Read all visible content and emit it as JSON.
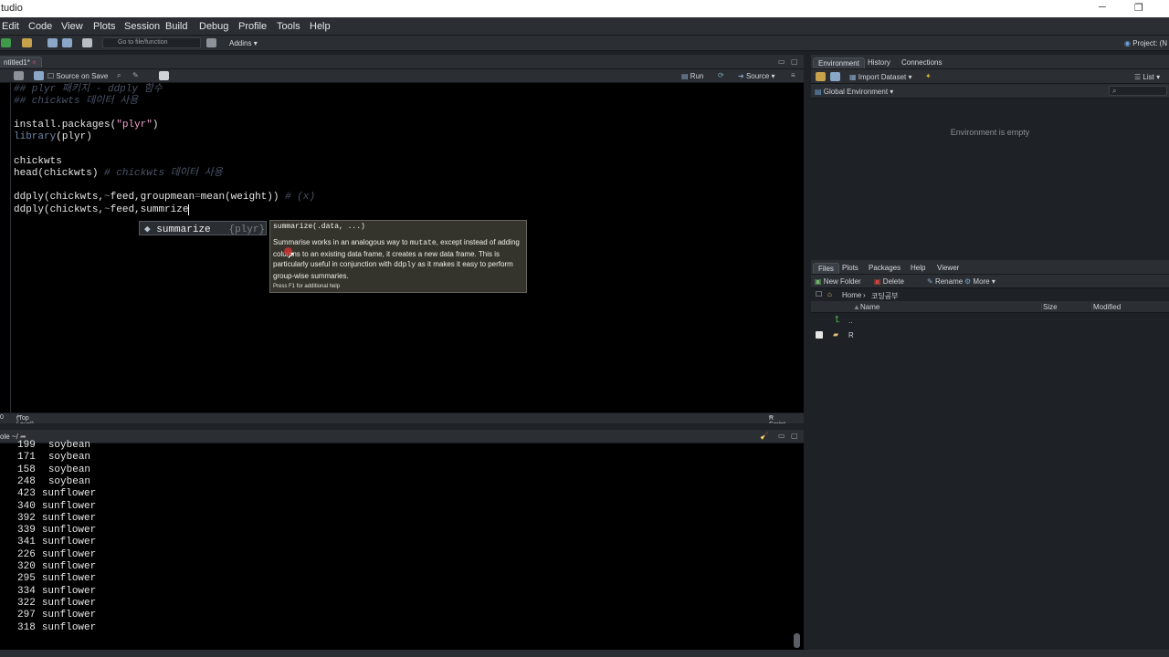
{
  "window": {
    "title": "tudio"
  },
  "menu": [
    "Edit",
    "Code",
    "View",
    "Plots",
    "Session",
    "Build",
    "Debug",
    "Profile",
    "Tools",
    "Help"
  ],
  "toolbar": {
    "goto_placeholder": "Go to file/function",
    "addins": "Addins",
    "project": "Project: (N"
  },
  "editor": {
    "tab_name": "ntitled1*",
    "source_on_save": "Source on Save",
    "run": "Run",
    "source": "Source",
    "status_pos": "0",
    "status_level": "(Top Level)",
    "status_type": "R Script",
    "lines": [
      {
        "text": "## plyr 패키지 - ddply 함수",
        "kind": "cmt"
      },
      {
        "text": "## chickwts 데이터 사용",
        "kind": "cmt"
      },
      {
        "text": "",
        "kind": "txt"
      },
      {
        "text": "install.packages(\"plyr\")",
        "kind": "install"
      },
      {
        "text": "library(plyr)",
        "kind": "lib"
      },
      {
        "text": "",
        "kind": "txt"
      },
      {
        "text": "chickwts",
        "kind": "txt"
      },
      {
        "text": "head(chickwts) # chickwts 데이터 사용",
        "kind": "head"
      },
      {
        "text": "",
        "kind": "txt"
      },
      {
        "text": "ddply(chickwts,~feed,groupmean=mean(weight)) # (x)",
        "kind": "ddply1"
      },
      {
        "text": "ddply(chickwts,~feed,summrize)",
        "kind": "txt"
      }
    ]
  },
  "autocomplete": {
    "item": "summarize",
    "pkg": "{plyr}",
    "signature": "summarize(.data, ...)",
    "description_1": "Summarise works in an analogous way to ",
    "code_mutate": "mutate",
    "description_2": ", except instead of adding columns to an existing data frame, it creates a new data frame. This is particularly useful in conjunction with ",
    "code_ddply": "ddply",
    "description_3": " as it makes it easy to perform group-wise summaries.",
    "hint": "Press F1 for additional help"
  },
  "console": {
    "title": "ole ~/",
    "rows": [
      {
        "n": "199",
        "feed": "soybean"
      },
      {
        "n": "171",
        "feed": "soybean"
      },
      {
        "n": "158",
        "feed": "soybean"
      },
      {
        "n": "248",
        "feed": "soybean"
      },
      {
        "n": "423",
        "feed": "sunflower"
      },
      {
        "n": "340",
        "feed": "sunflower"
      },
      {
        "n": "392",
        "feed": "sunflower"
      },
      {
        "n": "339",
        "feed": "sunflower"
      },
      {
        "n": "341",
        "feed": "sunflower"
      },
      {
        "n": "226",
        "feed": "sunflower"
      },
      {
        "n": "320",
        "feed": "sunflower"
      },
      {
        "n": "295",
        "feed": "sunflower"
      },
      {
        "n": "334",
        "feed": "sunflower"
      },
      {
        "n": "322",
        "feed": "sunflower"
      },
      {
        "n": "297",
        "feed": "sunflower"
      },
      {
        "n": "318",
        "feed": "sunflower"
      }
    ]
  },
  "environment": {
    "tabs": [
      "Environment",
      "History",
      "Connections"
    ],
    "import_dataset": "Import Dataset",
    "list": "List",
    "scope": "Global Environment",
    "empty_text": "Environment is empty"
  },
  "files": {
    "tabs": [
      "Files",
      "Plots",
      "Packages",
      "Help",
      "Viewer"
    ],
    "new_folder": "New Folder",
    "delete": "Delete",
    "rename": "Rename",
    "more": "More",
    "crumb_home": "Home",
    "crumb_dir": "코딩공부",
    "col_name": "Name",
    "col_size": "Size",
    "col_modified": "Modified",
    "entries": [
      ".. ",
      "R"
    ]
  },
  "colors": {
    "editor_bg": "#000000",
    "chrome": "#2b2f34",
    "comment": "#4a5468",
    "string": "#f2a3d0",
    "tooltip_bg": "#34332c"
  }
}
